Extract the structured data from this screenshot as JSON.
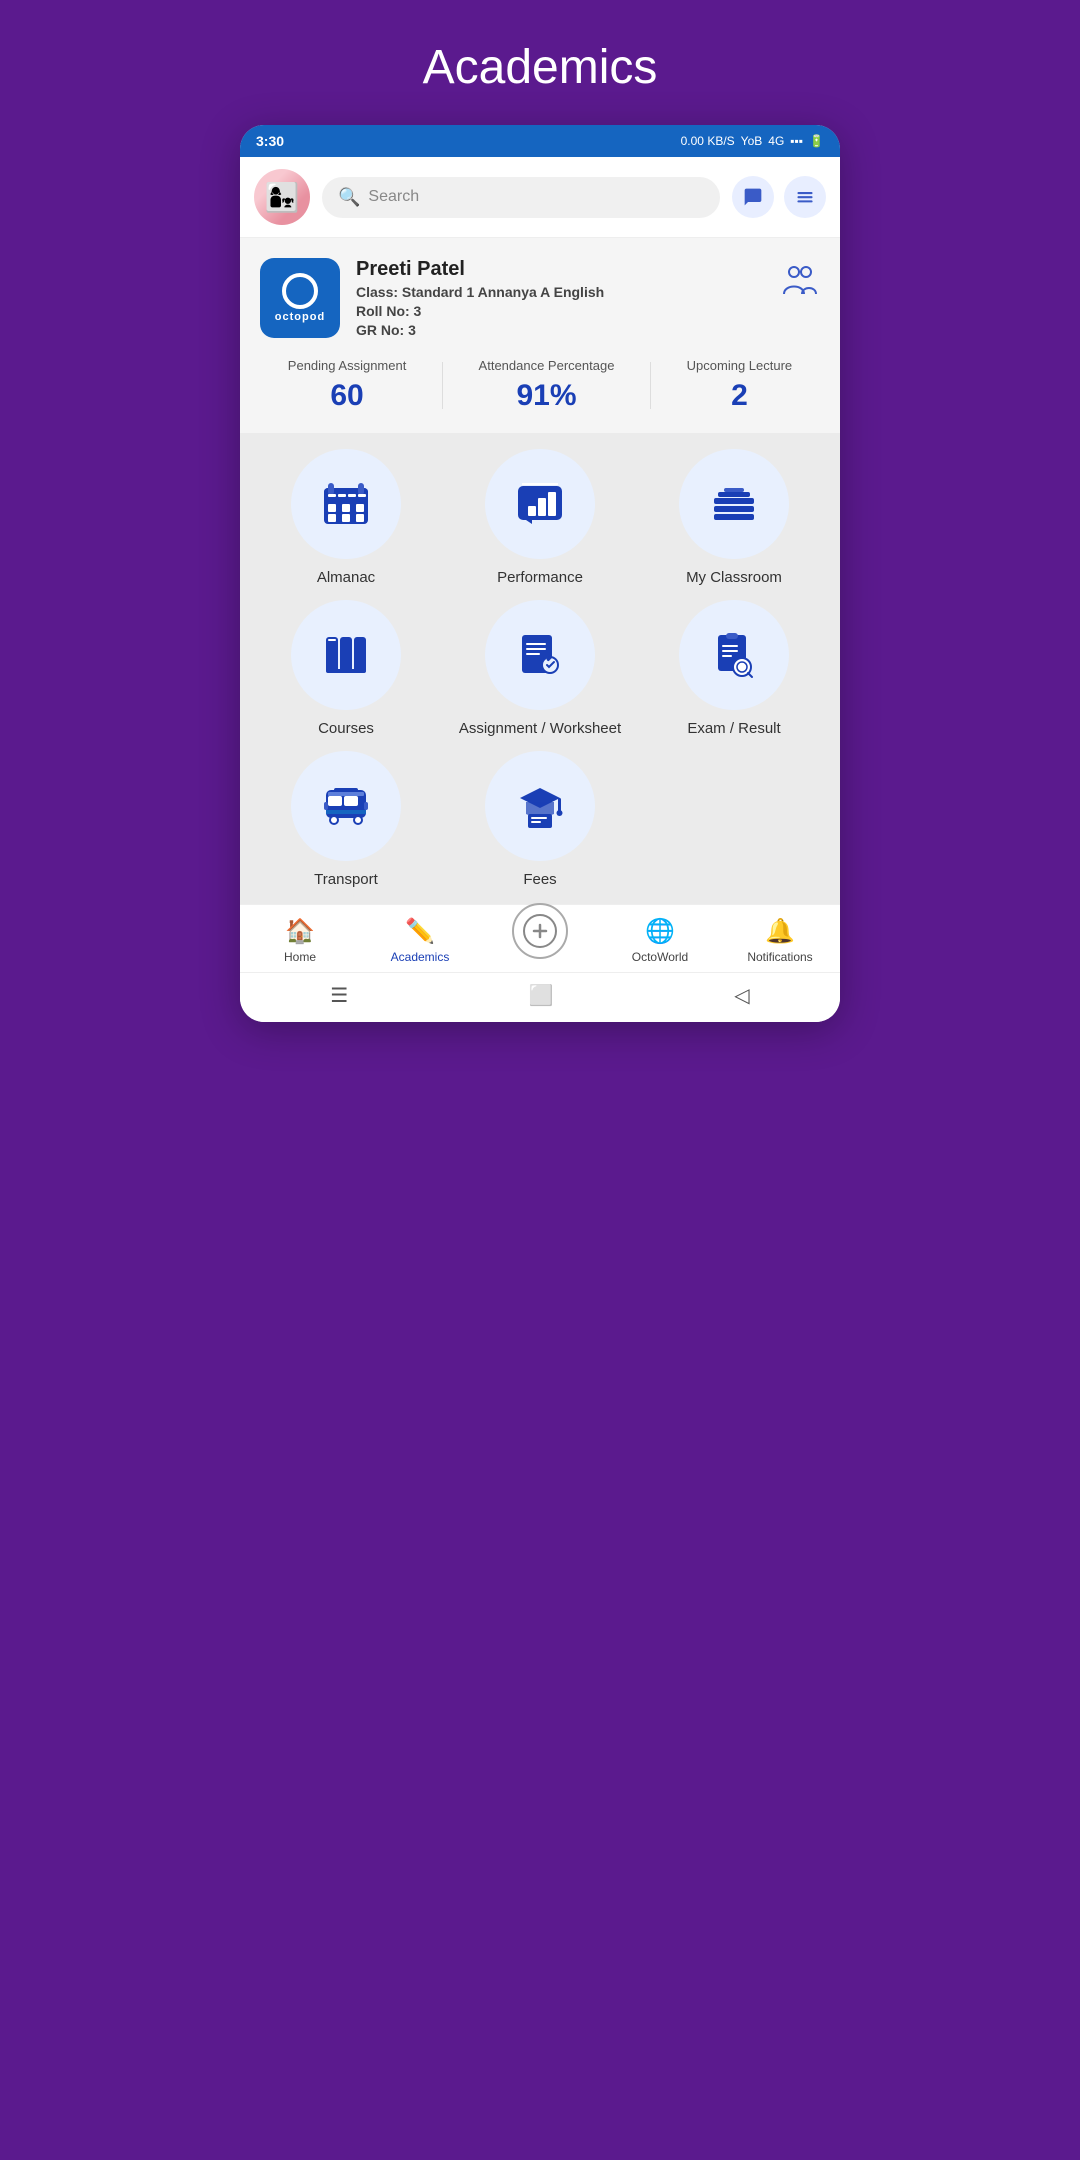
{
  "page": {
    "title": "Academics"
  },
  "statusBar": {
    "time": "3:30",
    "network": "0.00 KB/S",
    "carrier": "Yo",
    "signal": "4G"
  },
  "header": {
    "searchPlaceholder": "Search",
    "searchLabel": "Search"
  },
  "profile": {
    "logoText": "octopod",
    "name": "Preeti Patel",
    "classLabel": "Class:",
    "classValue": "Standard 1 Annanya A English",
    "rollLabel": "Roll No:",
    "rollValue": "3",
    "grLabel": "GR No:",
    "grValue": "3"
  },
  "stats": [
    {
      "label": "Pending Assignment",
      "value": "60"
    },
    {
      "label": "Attendance Percentage",
      "value": "91%"
    },
    {
      "label": "Upcoming Lecture",
      "value": "2"
    }
  ],
  "gridItems": [
    {
      "id": "almanac",
      "label": "Almanac",
      "icon": "calendar"
    },
    {
      "id": "performance",
      "label": "Performance",
      "icon": "performance"
    },
    {
      "id": "my-classroom",
      "label": "My Classroom",
      "icon": "classroom"
    },
    {
      "id": "courses",
      "label": "Courses",
      "icon": "books"
    },
    {
      "id": "assignment-worksheet",
      "label": "Assignment / Worksheet",
      "icon": "assignment"
    },
    {
      "id": "exam-result",
      "label": "Exam / Result",
      "icon": "exam"
    },
    {
      "id": "transport",
      "label": "Transport",
      "icon": "bus"
    },
    {
      "id": "fees",
      "label": "Fees",
      "icon": "fees"
    }
  ],
  "bottomNav": [
    {
      "id": "home",
      "label": "Home",
      "icon": "home",
      "active": false
    },
    {
      "id": "academics",
      "label": "Academics",
      "icon": "academics",
      "active": true
    },
    {
      "id": "octoworld-center",
      "label": "",
      "icon": "plus-badge",
      "active": false
    },
    {
      "id": "octoworld",
      "label": "OctoWorld",
      "icon": "globe",
      "active": false
    },
    {
      "id": "notifications",
      "label": "Notifications",
      "icon": "bell",
      "active": false
    }
  ]
}
